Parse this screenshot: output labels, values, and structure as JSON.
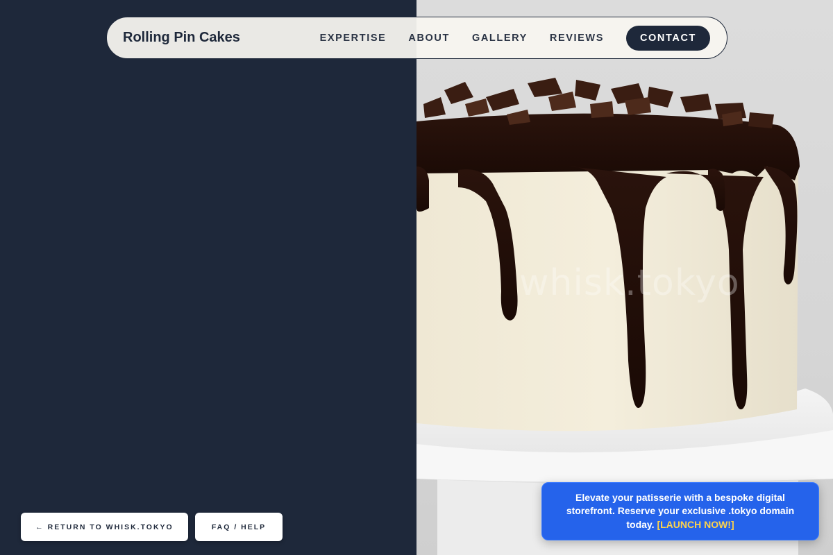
{
  "brand": {
    "name": "Rolling Pin Cakes"
  },
  "nav": {
    "items": [
      {
        "label": "EXPERTISE"
      },
      {
        "label": "ABOUT"
      },
      {
        "label": "GALLERY"
      },
      {
        "label": "REVIEWS"
      }
    ],
    "contact_label": "CONTACT"
  },
  "hero": {
    "watermark": "whisk.tokyo",
    "image": "chocolate-drip-cake"
  },
  "footer_buttons": {
    "return_label": "← RETURN TO WHISK.TOKYO",
    "faq_label": "FAQ / HELP"
  },
  "promo": {
    "text": "Elevate your patisserie with a bespoke digital storefront. Reserve your exclusive .tokyo domain today.",
    "cta": "[LAUNCH NOW!]"
  },
  "colors": {
    "navy": "#1e283a",
    "promo_blue": "#2563eb",
    "cta_yellow": "#fcd34d"
  }
}
